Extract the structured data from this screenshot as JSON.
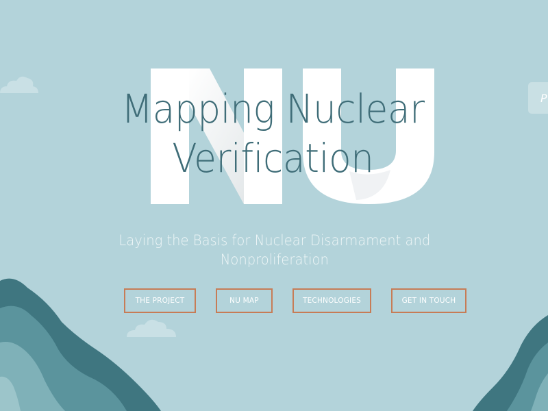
{
  "hero": {
    "watermark": "NU",
    "title_line1": "Mapping Nuclear",
    "title_line2": "Verification",
    "subtitle_line1": "Laying the Basis for Nuclear Disarmament and",
    "subtitle_line2": "Nonproliferation"
  },
  "nav": {
    "project_label": "THE PROJECT",
    "map_label": "NU MAP",
    "tech_label": "TECHNOLOGIES",
    "contact_label": "GET IN TOUCH"
  },
  "side_tab": {
    "label": "P"
  },
  "colors": {
    "background": "#b3d3da",
    "title": "#3f6d78",
    "button_border": "#c77c56",
    "hill_dark": "#3f7680",
    "hill_mid": "#5b949d",
    "hill_light": "#7fb1b8"
  },
  "icons": [
    "cloud-icon"
  ]
}
